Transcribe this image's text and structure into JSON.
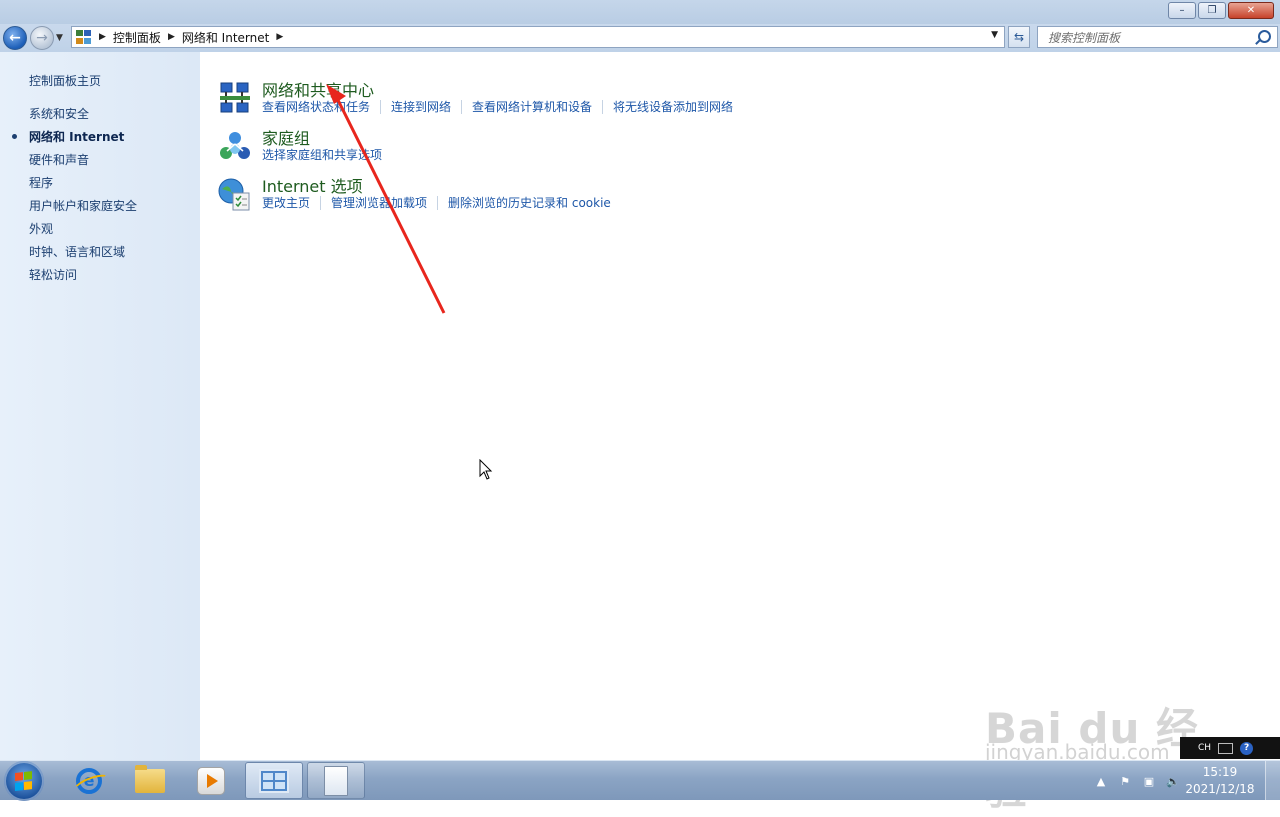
{
  "window": {
    "controls": {
      "minimize": "–",
      "maximize": "❐",
      "close": "✕"
    }
  },
  "navigation": {
    "breadcrumb": [
      "控制面板",
      "网络和 Internet"
    ],
    "search_placeholder": "搜索控制面板"
  },
  "sidebar": {
    "home": "控制面板主页",
    "items": [
      {
        "label": "系统和安全",
        "active": false
      },
      {
        "label": "网络和 Internet",
        "active": true
      },
      {
        "label": "硬件和声音",
        "active": false
      },
      {
        "label": "程序",
        "active": false
      },
      {
        "label": "用户帐户和家庭安全",
        "active": false
      },
      {
        "label": "外观",
        "active": false
      },
      {
        "label": "时钟、语言和区域",
        "active": false
      },
      {
        "label": "轻松访问",
        "active": false
      }
    ]
  },
  "categories": [
    {
      "title": "网络和共享中心",
      "icon": "network-icon",
      "links": [
        "查看网络状态和任务",
        "连接到网络",
        "查看网络计算机和设备",
        "将无线设备添加到网络"
      ]
    },
    {
      "title": "家庭组",
      "icon": "homegroup-icon",
      "links": [
        "选择家庭组和共享选项"
      ]
    },
    {
      "title": "Internet 选项",
      "icon": "internet-options-icon",
      "links": [
        "更改主页",
        "管理浏览器加载项",
        "删除浏览的历史记录和 cookie"
      ]
    }
  ],
  "watermark": {
    "brand": "Bai du 经验",
    "url": "jingyan.baidu.com"
  },
  "language_bar": {
    "lang": "CH"
  },
  "taskbar": {
    "apps": [
      "internet-explorer-icon",
      "explorer-folder-icon",
      "media-player-icon",
      "control-panel-icon",
      "document-icon"
    ]
  },
  "clock": {
    "time": "15:19",
    "date": "2021/12/18"
  },
  "colors": {
    "link": "#1e57a8",
    "category_title": "#1e5b1f",
    "annotation_arrow": "#e8261d"
  }
}
